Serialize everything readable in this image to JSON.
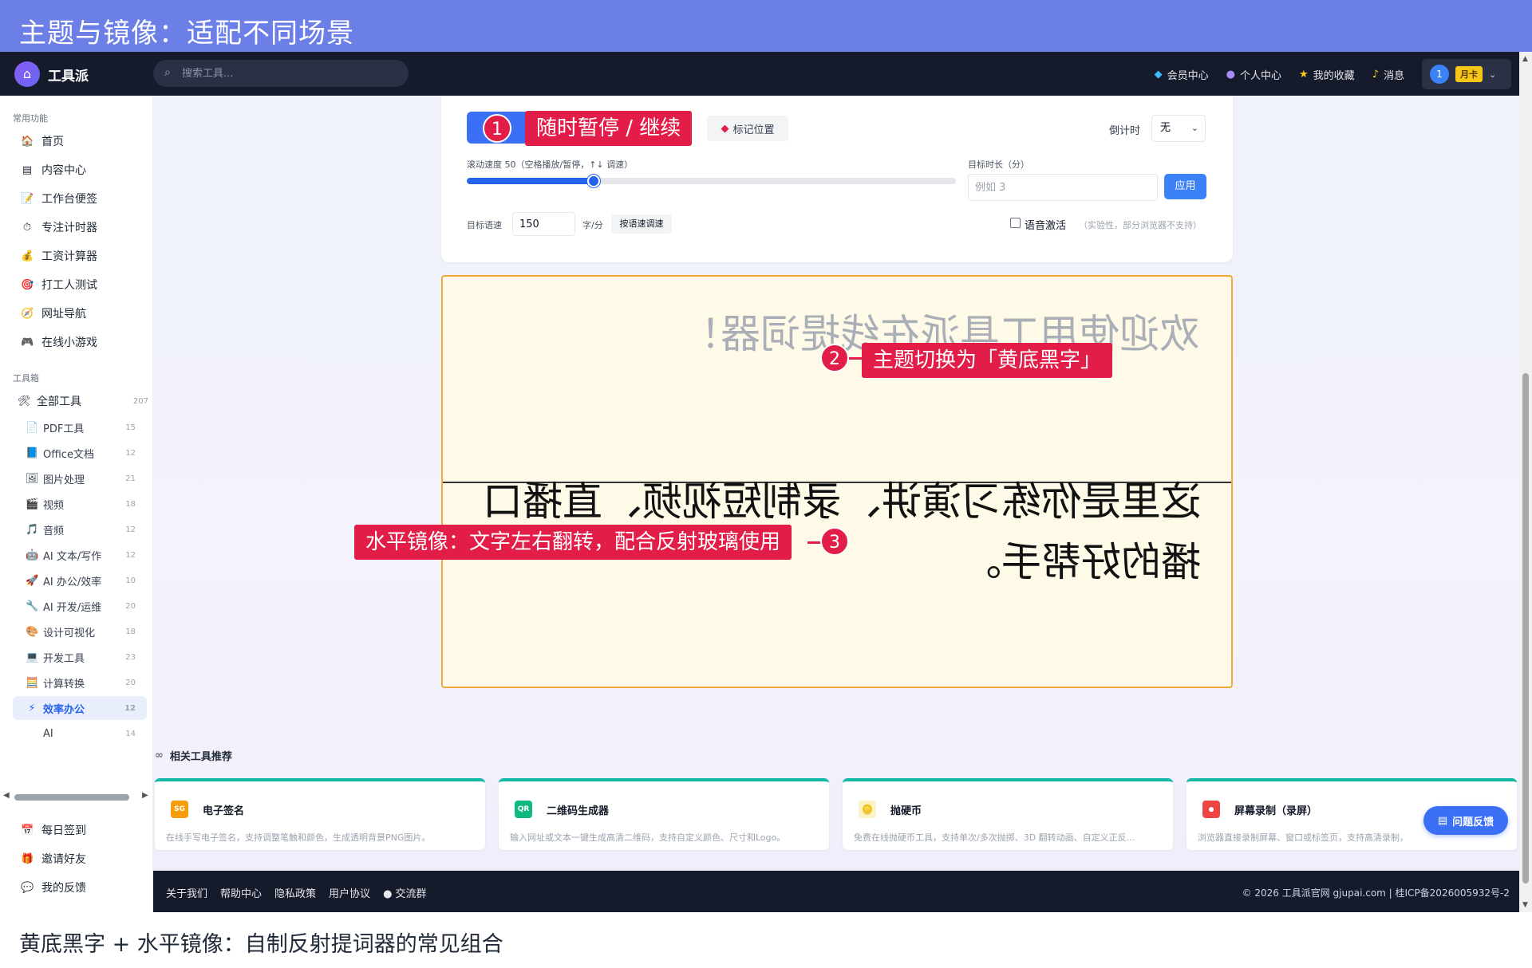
{
  "banner": {
    "title": "主题与镜像：适配不同场景"
  },
  "header": {
    "logo": "工具派",
    "search_placeholder": "搜索工具...",
    "nav": [
      {
        "icon": "diamond-icon",
        "label": "会员中心"
      },
      {
        "icon": "person-icon",
        "label": "个人中心"
      },
      {
        "icon": "star-icon",
        "label": "我的收藏"
      },
      {
        "icon": "bell-icon",
        "label": "消息"
      }
    ],
    "user": {
      "avatar": "1",
      "badge": "月卡"
    }
  },
  "sidebar": {
    "common_title": "常用功能",
    "common_items": [
      {
        "icon": "🏠",
        "label": "首页"
      },
      {
        "icon": "▤",
        "label": "内容中心"
      },
      {
        "icon": "📝",
        "label": "工作台便签"
      },
      {
        "icon": "⏱",
        "label": "专注计时器"
      },
      {
        "icon": "💰",
        "label": "工资计算器"
      },
      {
        "icon": "🎯",
        "label": "打工人测试"
      },
      {
        "icon": "🧭",
        "label": "网址导航"
      },
      {
        "icon": "🎮",
        "label": "在线小游戏"
      }
    ],
    "toolbox_title": "工具箱",
    "all_tools": {
      "icon": "🛠",
      "label": "全部工具",
      "count": "207"
    },
    "tool_items": [
      {
        "icon": "📄",
        "label": "PDF工具",
        "count": "15"
      },
      {
        "icon": "📘",
        "label": "Office文档",
        "count": "12"
      },
      {
        "icon": "🖼",
        "label": "图片处理",
        "count": "21"
      },
      {
        "icon": "🎬",
        "label": "视频",
        "count": "18"
      },
      {
        "icon": "🎵",
        "label": "音频",
        "count": "12"
      },
      {
        "icon": "🤖",
        "label": "AI 文本/写作",
        "count": "12"
      },
      {
        "icon": "🚀",
        "label": "AI 办公/效率",
        "count": "10"
      },
      {
        "icon": "🔧",
        "label": "AI 开发/运维",
        "count": "20"
      },
      {
        "icon": "🎨",
        "label": "设计可视化",
        "count": "18"
      },
      {
        "icon": "💻",
        "label": "开发工具",
        "count": "23"
      },
      {
        "icon": "🧮",
        "label": "计算转换",
        "count": "20"
      },
      {
        "icon": "⚡",
        "label": "效率办公",
        "count": "12"
      },
      {
        "icon": "",
        "label": "AI",
        "count": "14"
      }
    ],
    "active_tool": "效率办公",
    "bottom_items": [
      {
        "icon": "📅",
        "label": "每日签到"
      },
      {
        "icon": "🎁",
        "label": "邀请好友"
      },
      {
        "icon": "💬",
        "label": "我的反馈"
      }
    ]
  },
  "controls": {
    "mark_label": "标记位置",
    "countdown_label": "倒计时",
    "countdown_value": "无",
    "speed_label": "滚动速度 50（空格播放/暂停，↑↓ 调速）",
    "speed_level": 0.26,
    "duration_label": "目标时长（分）",
    "duration_placeholder": "例如 3",
    "apply_label": "应用",
    "rate_label": "目标语速",
    "rate_value": "150",
    "rate_unit": "字/分",
    "rate_button": "按语速调速",
    "voice_label": "语音激活",
    "voice_note": "（实验性，部分浏览器不支持）"
  },
  "prompter": {
    "faded_text": "欢迎使用工具派在线提词器！",
    "line1": "这里是你练习演讲、录制短视频、直播口",
    "line2": "播的好帮手。",
    "colors": {
      "background": "#fefae7",
      "text": "#111111",
      "border": "#f2a93b"
    }
  },
  "callouts": [
    {
      "number": "1",
      "text": "随时暂停 / 继续"
    },
    {
      "number": "2",
      "text": "主题切换为「黄底黑字」"
    },
    {
      "number": "3",
      "text": "水平镜像：文字左右翻转，配合反射玻璃使用"
    }
  ],
  "related": {
    "title": "相关工具推荐",
    "cards": [
      {
        "icon_text": "SG",
        "icon_color": "#f59e0b",
        "name": "电子签名",
        "desc": "在线手写电子签名，支持调整笔触和颜色，生成透明背景PNG图片。"
      },
      {
        "icon_text": "QR",
        "icon_color": "#10b981",
        "name": "二维码生成器",
        "desc": "输入网址或文本一键生成高清二维码，支持自定义颜色、尺寸和Logo。"
      },
      {
        "icon_text": "🪙",
        "icon_color": "#fef3c7",
        "name": "抛硬币",
        "desc": "免费在线抛硬币工具，支持单次/多次抛掷、3D 翻转动画、自定义正反..."
      },
      {
        "icon_text": "⏺",
        "icon_color": "#ef4444",
        "name": "屏幕录制（录屏）",
        "desc": "浏览器直接录制屏幕、窗口或标签页，支持高清录制，"
      }
    ]
  },
  "feedback_button": "问题反馈",
  "footer": {
    "links": [
      "关于我们",
      "帮助中心",
      "隐私政策",
      "用户协议",
      "交流群"
    ],
    "copyright": "© 2026 工具派官网 gjupai.com | 桂ICP备2026005932号-2"
  },
  "caption": "黄底黑字 + 水平镜像：自制反射提词器的常见组合"
}
